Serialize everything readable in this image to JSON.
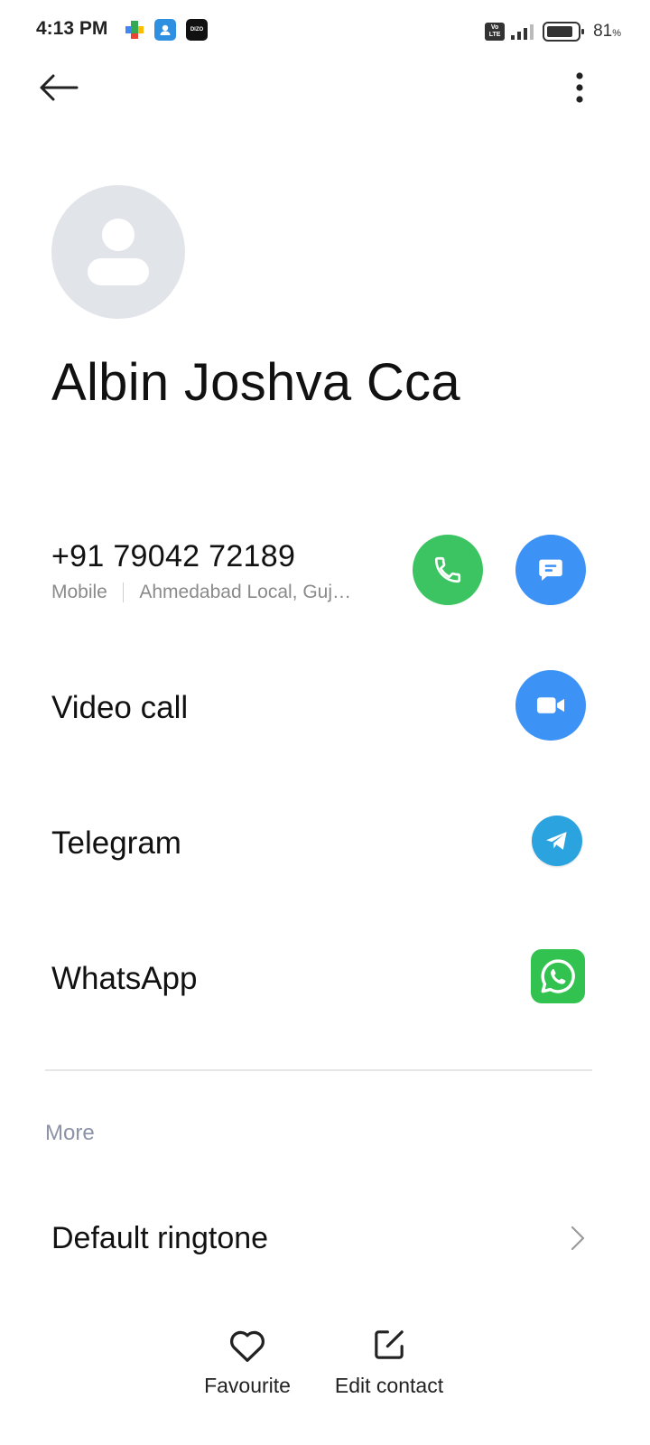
{
  "status_bar": {
    "time": "4:13 PM",
    "battery_percent": "81",
    "battery_unit": "%",
    "volte_label_top": "Vo",
    "volte_label_bottom": "LTE",
    "dizo_label": "DIZO",
    "notification_icons": [
      "play-games-icon",
      "contacts-app-icon",
      "dizo-icon"
    ]
  },
  "app_bar": {
    "back_icon": "arrow-left-icon",
    "more_icon": "more-vertical-icon"
  },
  "contact": {
    "name": "Albin Joshva Cca",
    "avatar_icon": "person-placeholder-icon"
  },
  "phone": {
    "number": "+91 79042 72189",
    "type": "Mobile",
    "location": "Ahmedabad Local, Guj…"
  },
  "actions": {
    "video_call": "Video call",
    "telegram": "Telegram",
    "whatsapp": "WhatsApp"
  },
  "more_section": {
    "header": "More",
    "default_ringtone": "Default ringtone"
  },
  "bottom_bar": {
    "favourite": "Favourite",
    "edit_contact": "Edit contact"
  },
  "colors": {
    "call_green": "#3cc462",
    "action_blue": "#3d92f5",
    "telegram_blue": "#2aa3de",
    "whatsapp_green": "#31c24f",
    "avatar_bg": "#e1e4e9"
  }
}
